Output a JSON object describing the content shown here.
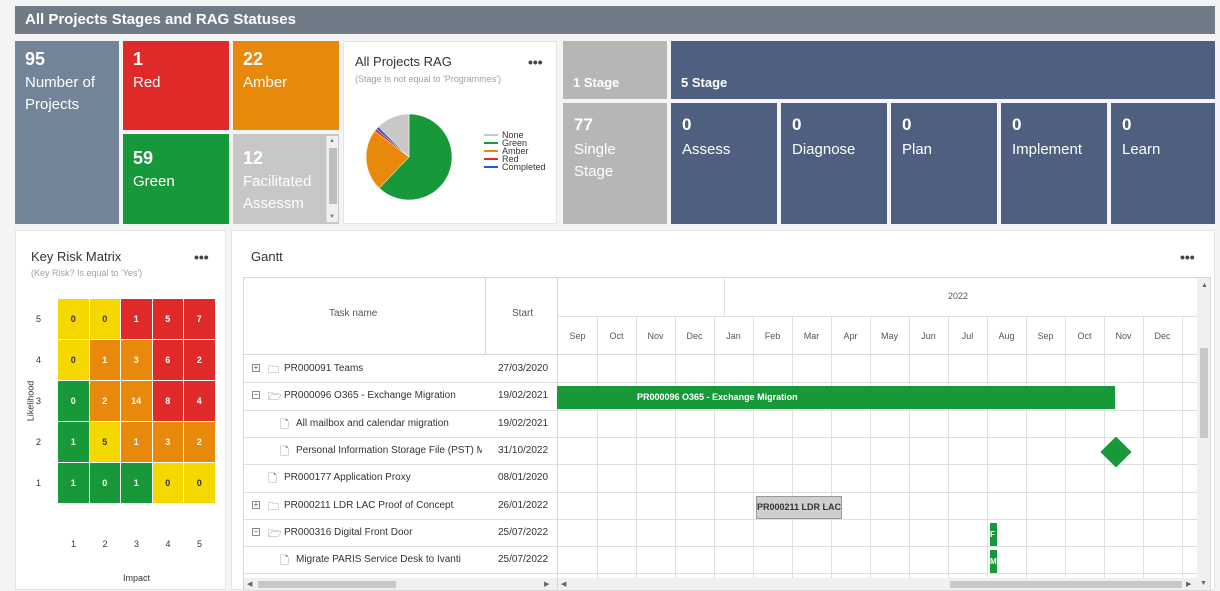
{
  "header": {
    "title": "All Projects Stages and RAG Statuses"
  },
  "tiles": {
    "projects": {
      "num": "95",
      "label1": "Number of",
      "label2": "Projects",
      "color": "#728498"
    },
    "red": {
      "num": "1",
      "label": "Red",
      "color": "#e02a2a"
    },
    "amber": {
      "num": "22",
      "label": "Amber",
      "color": "#e8890c"
    },
    "green": {
      "num": "59",
      "label": "Green",
      "color": "#17993a"
    },
    "facilitated": {
      "num": "12",
      "label1": "Facilitated",
      "label2": "Assessm",
      "color": "#c7c7c7"
    }
  },
  "rag_chart": {
    "title": "All Projects RAG",
    "subtitle": "(Stage Is not equal to 'Programmes')",
    "menu": "•••",
    "legend": [
      {
        "label": "None",
        "color": "#c8c8c8"
      },
      {
        "label": "Green",
        "color": "#17993a"
      },
      {
        "label": "Amber",
        "color": "#e8890c"
      },
      {
        "label": "Red",
        "color": "#e02a2a"
      },
      {
        "label": "Completed",
        "color": "#1f5fc9"
      }
    ]
  },
  "chart_data": {
    "type": "pie",
    "title": "All Projects RAG",
    "categories": [
      "None",
      "Green",
      "Amber",
      "Red",
      "Completed"
    ],
    "values": [
      12,
      59,
      22,
      1,
      1
    ]
  },
  "stages": {
    "one_stage": {
      "title": "1 Stage",
      "num": "77",
      "label1": "Single",
      "label2": "Stage"
    },
    "five_stage": {
      "title": "5 Stage"
    },
    "items": [
      {
        "num": "0",
        "label": "Assess"
      },
      {
        "num": "0",
        "label": "Diagnose"
      },
      {
        "num": "0",
        "label": "Plan"
      },
      {
        "num": "0",
        "label": "Implement"
      },
      {
        "num": "0",
        "label": "Learn"
      }
    ]
  },
  "risk_matrix": {
    "title": "Key Risk Matrix",
    "subtitle": "(Key Risk? Is equal to 'Yes')",
    "menu": "•••",
    "ylabel": "Likelihood",
    "xlabel": "Impact",
    "row_labels": [
      "5",
      "4",
      "3",
      "2",
      "1"
    ],
    "col_labels": [
      "1",
      "2",
      "3",
      "4",
      "5"
    ],
    "cells": [
      [
        "0",
        "0",
        "1",
        "5",
        "7"
      ],
      [
        "0",
        "1",
        "3",
        "6",
        "2"
      ],
      [
        "0",
        "2",
        "14",
        "8",
        "4"
      ],
      [
        "1",
        "5",
        "1",
        "3",
        "2"
      ],
      [
        "1",
        "0",
        "1",
        "0",
        "0"
      ]
    ],
    "colors": {
      "green": "#17993a",
      "yellow": "#f5d800",
      "amber": "#e8890c",
      "red": "#e02a2a"
    }
  },
  "gantt": {
    "title": "Gantt",
    "menu": "•••",
    "col_task": "Task name",
    "col_start": "Start",
    "year": "2022",
    "months": [
      "Sep",
      "Oct",
      "Nov",
      "Dec",
      "Jan",
      "Feb",
      "Mar",
      "Apr",
      "May",
      "Jun",
      "Jul",
      "Aug",
      "Sep",
      "Oct",
      "Nov",
      "Dec"
    ],
    "rows": [
      {
        "name": "PR000091 Teams",
        "start": "27/03/2020",
        "icon": "folder",
        "expand": "+"
      },
      {
        "name": "PR000096 O365 - Exchange Migration",
        "start": "19/02/2021",
        "icon": "folder-open",
        "expand": "-"
      },
      {
        "name": "All mailbox and calendar migration",
        "start": "19/02/2021",
        "icon": "file",
        "expand": ""
      },
      {
        "name": "Personal Information Storage File (PST) M",
        "start": "31/10/2022",
        "icon": "file",
        "expand": ""
      },
      {
        "name": "PR000177 Application Proxy",
        "start": "08/01/2020",
        "icon": "file",
        "expand": ""
      },
      {
        "name": "PR000211 LDR LAC Proof of Concept",
        "start": "26/01/2022",
        "icon": "folder",
        "expand": "+"
      },
      {
        "name": "PR000316 Digital Front Door",
        "start": "25/07/2022",
        "icon": "folder-open",
        "expand": "-"
      },
      {
        "name": "Migrate PARIS Service Desk to Ivanti",
        "start": "25/07/2022",
        "icon": "file",
        "expand": ""
      }
    ],
    "bars": {
      "exchange_label": "PR000096 O365 - Exchange Migration",
      "ldr_label": "PR000211 LDR LAC",
      "dfd_label": "F",
      "paris_label": "M"
    }
  }
}
